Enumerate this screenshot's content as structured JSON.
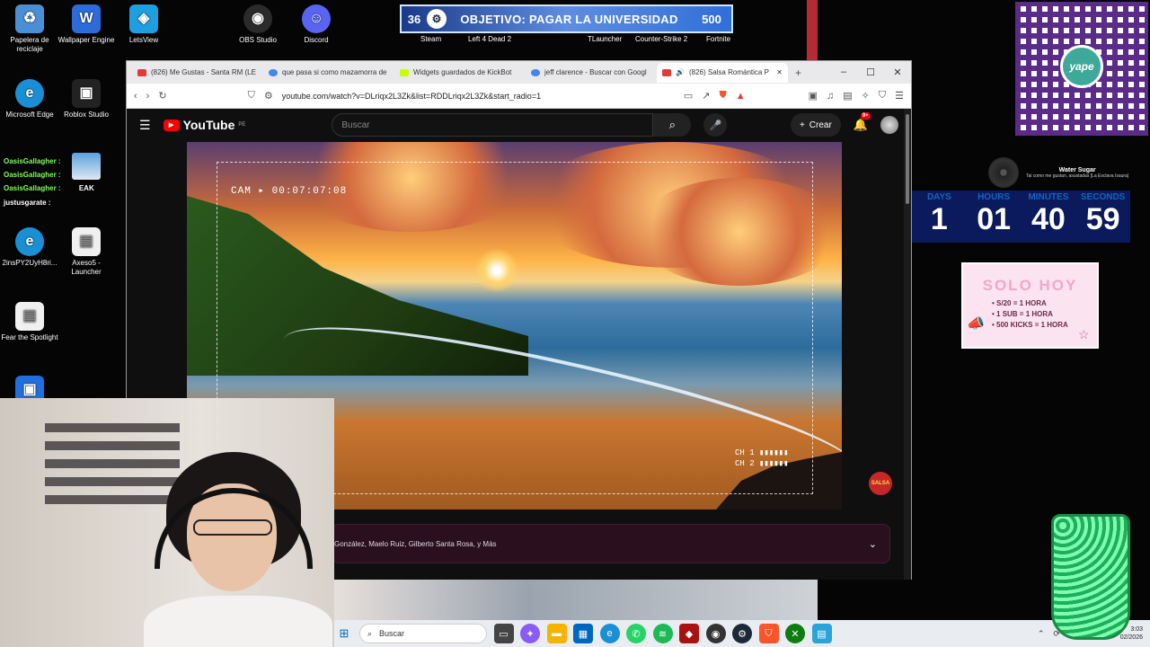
{
  "desktop_icons": [
    {
      "label": "Papelera de reciclaje",
      "icon": "recycle-bin-icon",
      "color": "#4a8fd6"
    },
    {
      "label": "Wallpaper Engine",
      "icon": "wallpaper-engine-icon",
      "color": "#2d6bd8"
    },
    {
      "label": "LetsView",
      "icon": "letsview-icon",
      "color": "#1f9fe0"
    },
    {
      "label": "OBS Studio",
      "icon": "obs-icon",
      "color": "#2b2b2b"
    },
    {
      "label": "Discord",
      "icon": "discord-icon",
      "color": "#5865f2"
    },
    {
      "label": "Microsoft Edge",
      "icon": "edge-icon",
      "color": "#1b8fd6"
    },
    {
      "label": "Roblox Studio",
      "icon": "roblox-icon",
      "color": "#222222"
    },
    {
      "label": "2insPY2UyH8ri...",
      "icon": "edge-icon",
      "color": "#1b8fd6"
    },
    {
      "label": "Axeso5 - Launcher",
      "icon": "file-icon",
      "color": "#f0f0f0"
    },
    {
      "label": "Fear the Spotlight",
      "icon": "file-icon",
      "color": "#f0f0f0"
    }
  ],
  "goal_bar": {
    "left_count": "36",
    "title": "OBJETIVO: PAGAR LA UNIVERSIDAD",
    "right_count": "500"
  },
  "top_labels": [
    "Steam",
    "Left 4 Dead 2",
    "TLauncher",
    "Counter-Strike 2",
    "Fortnite"
  ],
  "browser": {
    "tabs": [
      {
        "title": "(826) Me Gustas - Santa RM (LE",
        "fav": "#e53935",
        "active": false
      },
      {
        "title": "que pasa si como mazamorra de",
        "fav": "#4285f4",
        "active": false
      },
      {
        "title": "Widgets guardados de KickBot",
        "fav": "#c6ff00",
        "active": false
      },
      {
        "title": "jeff clarence - Buscar con Googl",
        "fav": "#4285f4",
        "active": false
      },
      {
        "title": "(826) Salsa Romántica P",
        "fav": "#e53935",
        "active": true
      }
    ],
    "new_tab": "+",
    "controls": {
      "minimize": "–",
      "maximize": "☐",
      "close": "✕"
    },
    "url": "youtube.com/watch?v=DLriqx2L3Zk&list=RDDLriqx2L3Zk&start_radio=1"
  },
  "youtube": {
    "logo": "YouTube",
    "region": "PE",
    "search_placeholder": "Buscar",
    "create_label": "Crear",
    "notif_count": "9+",
    "video_overlay": {
      "cam": "CAM ▸ 00:07:07:08",
      "ch1": "CH 1 ▮▮▮▮▮▮",
      "ch2": "CH 2 ▮▮▮▮▮▮"
    },
    "channel_badge": "SALSA",
    "playlist_text": "González, Maelo Ruiz, Gilberto Santa Rosa, y Más"
  },
  "chat": [
    {
      "name": "OasisGallagher :"
    },
    {
      "name": "OasisGallagher :"
    },
    {
      "name": "OasisGallagher :",
      "text": "EAK"
    },
    {
      "name": "justusgarate :"
    }
  ],
  "music_widget": {
    "title": "Water Sugar",
    "subtitle": "Tal como me gustan, asustadas [La Esclava Isaura]"
  },
  "countdown": [
    {
      "label": "DAYS",
      "value": "1"
    },
    {
      "label": "HOURS",
      "value": "01"
    },
    {
      "label": "MINUTES",
      "value": "40"
    },
    {
      "label": "SECONDS",
      "value": "59"
    }
  ],
  "solo_hoy": {
    "title": "SOLO HOY",
    "items": [
      "• S/20 = 1 HORA",
      "• 1 SUB = 1 HORA",
      "• 500 KICKS = 1 HORA"
    ]
  },
  "qr": {
    "brand": "yape"
  },
  "taskbar": {
    "search_placeholder": "Buscar",
    "apps": [
      {
        "icon": "task-view-icon",
        "color": "#444"
      },
      {
        "icon": "copilot-icon",
        "color": "#8a5cf6"
      },
      {
        "icon": "file-explorer-icon",
        "color": "#f5b400"
      },
      {
        "icon": "store-icon",
        "color": "#0067c0"
      },
      {
        "icon": "edge-icon",
        "color": "#1b8fd6"
      },
      {
        "icon": "whatsapp-icon",
        "color": "#25d366"
      },
      {
        "icon": "spotify-icon",
        "color": "#1db954"
      },
      {
        "icon": "dota-icon",
        "color": "#a11"
      },
      {
        "icon": "obs-icon",
        "color": "#333"
      },
      {
        "icon": "steam-icon",
        "color": "#1b2838"
      },
      {
        "icon": "brave-icon",
        "color": "#fb542b"
      },
      {
        "icon": "xbox-icon",
        "color": "#107c10"
      },
      {
        "icon": "notepad-icon",
        "color": "#2aa3d8"
      }
    ],
    "lang": "ES",
    "lang2": "ES",
    "time": "3:03",
    "date": "02/2026"
  }
}
